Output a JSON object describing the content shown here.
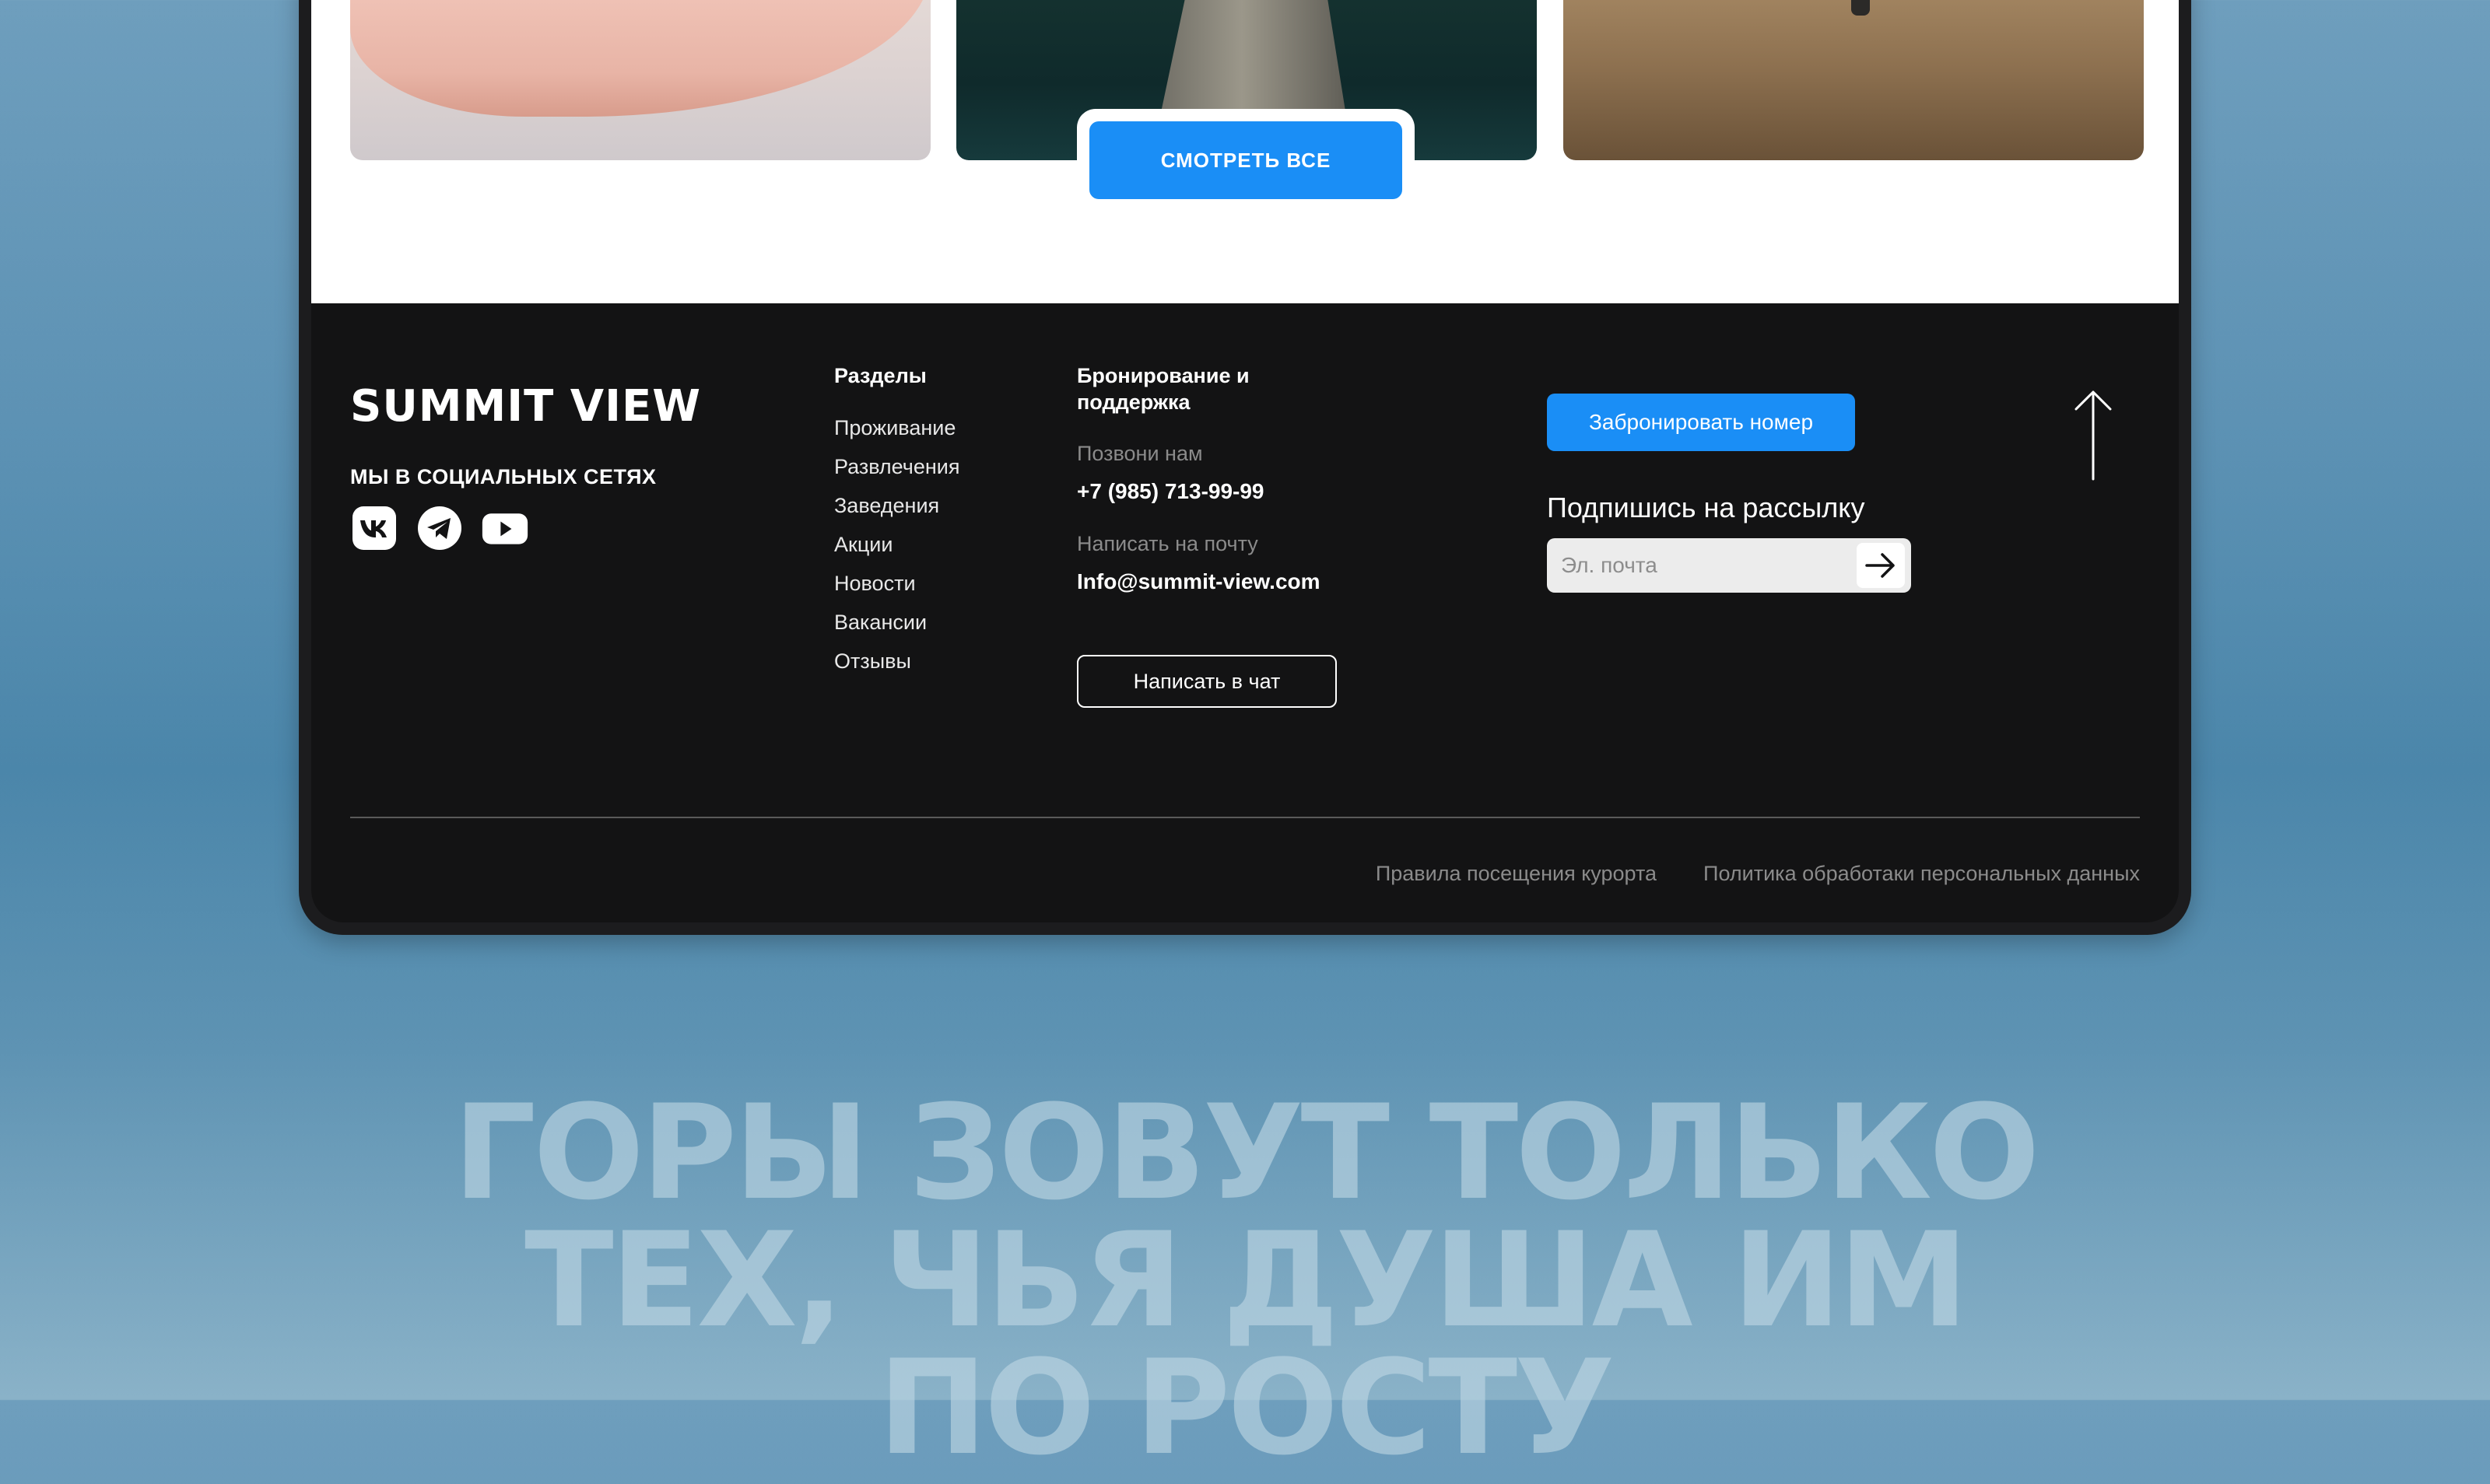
{
  "gallery": {
    "see_all_label": "СМОТРЕТЬ ВСЕ"
  },
  "footer": {
    "logo": "SUMMIT VIEW",
    "social_title": "МЫ В СОЦИАЛЬНЫХ СЕТЯХ",
    "social_icons": [
      "vk-icon",
      "telegram-icon",
      "youtube-icon"
    ],
    "sections_title": "Разделы",
    "sections": [
      "Проживание",
      "Развлечения",
      "Заведения",
      "Акции",
      "Новости",
      "Вакансии",
      "Отзывы"
    ],
    "booking_title_line1": "Бронирование и",
    "booking_title_line2": "поддержка",
    "call_label": "Позвони нам",
    "phone": "+7 (985) 713-99-99",
    "mail_label": "Написать на почту",
    "email": "Info@summit-view.com",
    "chat_button": "Написать в чат",
    "book_button": "Забронировать номер",
    "subscribe_title": "Подпишись на рассылку",
    "email_placeholder": "Эл. почта",
    "bottom_links": [
      "Правила посещения курорта",
      "Политика обработаки персональных данных"
    ],
    "accent_color": "#1a8ef6",
    "background_color": "#131314"
  },
  "slogan": {
    "line1": "ГОРЫ ЗОВУТ ТОЛЬКО",
    "line2": "ТЕХ, ЧЬЯ ДУША ИМ",
    "line3": "ПО РОСТУ"
  }
}
